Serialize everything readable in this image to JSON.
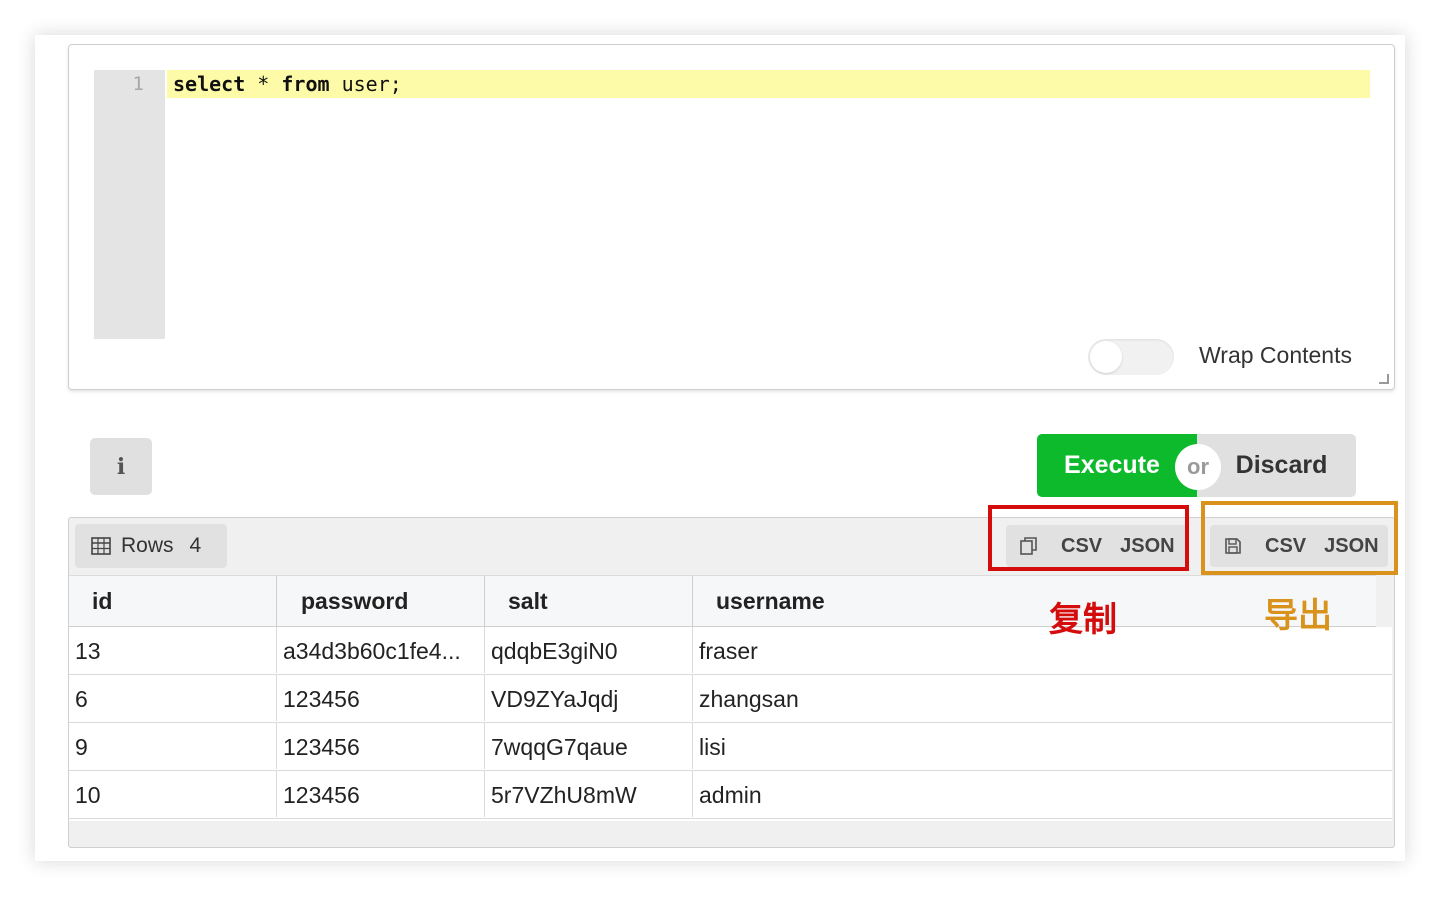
{
  "editor": {
    "line_number": "1",
    "code": {
      "kw1": "select",
      "star": " * ",
      "kw2": "from",
      "rest": " user;"
    },
    "wrap_label": "Wrap Contents",
    "wrap_enabled": false
  },
  "toolbar": {
    "info_label": "i",
    "execute_label": "Execute",
    "or_label": "or",
    "discard_label": "Discard"
  },
  "results": {
    "rows_label": "Rows",
    "rows_count": "4",
    "copy_options": [
      "CSV",
      "JSON"
    ],
    "export_options": [
      "CSV",
      "JSON"
    ],
    "columns": [
      "id",
      "password",
      "salt",
      "username"
    ],
    "rows": [
      [
        "13",
        "a34d3b60c1fe4...",
        "qdqbE3giN0",
        "fraser"
      ],
      [
        "6",
        "123456",
        "VD9ZYaJqdj",
        "zhangsan"
      ],
      [
        "9",
        "123456",
        "7wqqG7qaue",
        "lisi"
      ],
      [
        "10",
        "123456",
        "5r7VZhU8mW",
        "admin"
      ]
    ]
  },
  "annotations": {
    "copy": "复制",
    "export": "导出",
    "copy_color": "#d40c0c",
    "export_color": "#d9921c"
  },
  "colors": {
    "execute": "#0dba2c",
    "active_line": "#fdfba8"
  },
  "icons": {
    "rows": "table-icon",
    "copy": "copy-icon",
    "export": "save-icon"
  }
}
